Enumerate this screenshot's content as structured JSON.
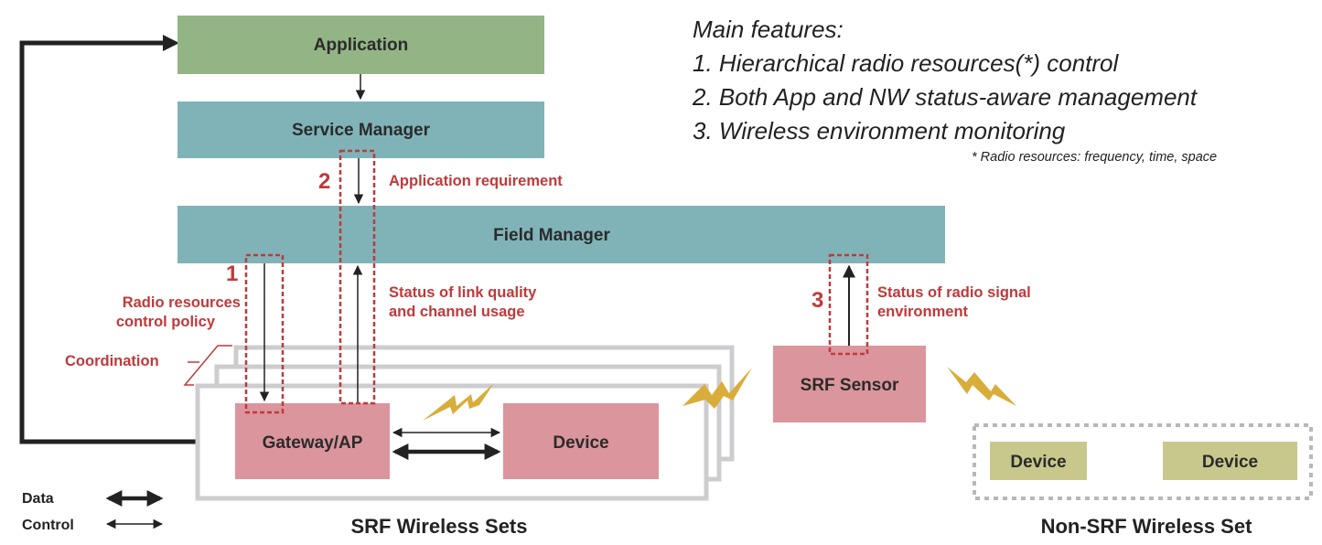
{
  "features": {
    "heading": "Main features:",
    "items": [
      "1. Hierarchical radio resources(*) control",
      "2. Both App and NW status-aware management",
      "3. Wireless environment monitoring"
    ],
    "footnote": "* Radio resources: frequency, time, space"
  },
  "blocks": {
    "application": "Application",
    "service_manager": "Service Manager",
    "field_manager": "Field Manager",
    "gateway": "Gateway/AP",
    "device": "Device",
    "srf_sensor": "SRF Sensor",
    "non_srf_device_1": "Device",
    "non_srf_device_2": "Device"
  },
  "annotations": {
    "num_1": "1",
    "num_2": "2",
    "num_3": "3",
    "app_requirement": "Application requirement",
    "radio_policy_line1": "Radio resources",
    "radio_policy_line2": "control policy",
    "link_status_line1": "Status of link quality",
    "link_status_line2": "and channel usage",
    "radio_env_line1": "Status of radio signal",
    "radio_env_line2": "environment",
    "coordination": "Coordination"
  },
  "groups": {
    "srf_sets": "SRF Wireless Sets",
    "non_srf_set": "Non-SRF Wireless Set"
  },
  "legend": {
    "data": "Data",
    "control": "Control"
  },
  "colors": {
    "application": "#93b585",
    "manager": "#80b3b8",
    "node": "#db959c",
    "non_srf_device": "#c8c88c",
    "annotation": "#c0393b",
    "lightning": "#d9ad3a",
    "frame": "#cdcdcf"
  }
}
